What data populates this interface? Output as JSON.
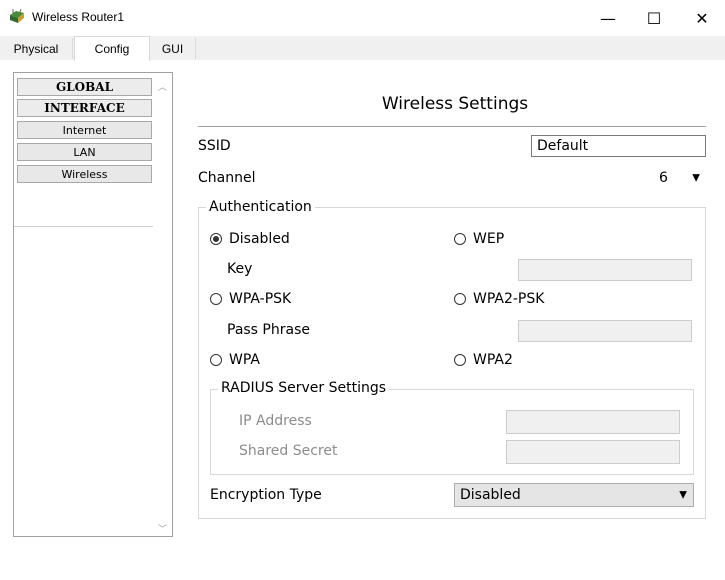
{
  "window": {
    "title": "Wireless Router1",
    "minimize_glyph": "—",
    "maximize_glyph": "☐",
    "close_glyph": "✕"
  },
  "tabs": [
    {
      "label": "Physical"
    },
    {
      "label": "Config",
      "selected": true
    },
    {
      "label": "GUI"
    }
  ],
  "sidebar": {
    "items": [
      {
        "label": "GLOBAL",
        "header": true
      },
      {
        "label": "INTERFACE",
        "header": true
      },
      {
        "label": "Internet"
      },
      {
        "label": "LAN"
      },
      {
        "label": "Wireless"
      }
    ]
  },
  "panel": {
    "title": "Wireless Settings",
    "ssid": {
      "label": "SSID",
      "value": "Default"
    },
    "channel": {
      "label": "Channel",
      "value": "6"
    },
    "authentication": {
      "legend": "Authentication",
      "options": {
        "disabled": {
          "label": "Disabled",
          "checked": true
        },
        "wep": {
          "label": "WEP",
          "checked": false
        },
        "wpa_psk": {
          "label": "WPA-PSK",
          "checked": false
        },
        "wpa2_psk": {
          "label": "WPA2-PSK",
          "checked": false
        },
        "wpa": {
          "label": "WPA",
          "checked": false
        },
        "wpa2": {
          "label": "WPA2",
          "checked": false
        }
      },
      "key_label": "Key",
      "key_value": "",
      "pass_phrase_label": "Pass Phrase",
      "pass_phrase_value": ""
    },
    "radius": {
      "legend": "RADIUS Server Settings",
      "ip_label": "IP Address",
      "ip_value": "",
      "secret_label": "Shared Secret",
      "secret_value": ""
    },
    "encryption": {
      "label": "Encryption Type",
      "value": "Disabled"
    }
  }
}
